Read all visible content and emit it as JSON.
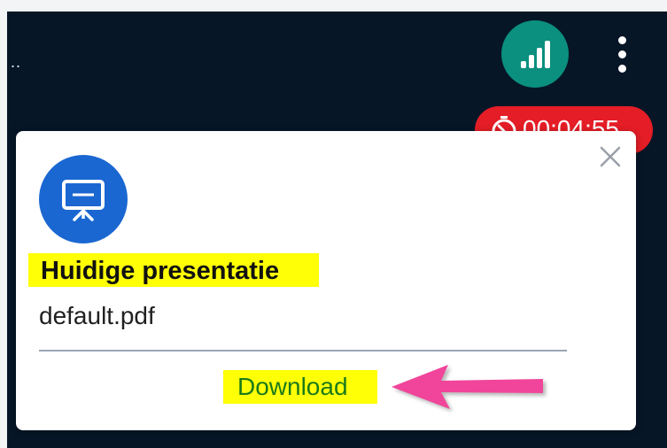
{
  "header": {
    "menu_dots": "..",
    "connection_icon": "signal-bars-icon",
    "more_icon": "vertical-ellipsis-icon"
  },
  "timer": {
    "icon": "stopwatch-icon",
    "value": "00:04:55"
  },
  "card": {
    "close_icon": "close-icon",
    "presentation_icon": "presentation-screen-icon",
    "title": "Huidige presentatie",
    "filename": "default.pdf",
    "download_label": "Download",
    "annotation_arrow": "pink-arrow-icon"
  },
  "colors": {
    "app_background": "#061627",
    "connection_button": "#0b8f7e",
    "timer_background": "#e41d26",
    "presentation_icon_background": "#1a67d2",
    "highlight": "#ffff06",
    "download_text": "#1a7a1a",
    "arrow": "#f0449a"
  }
}
